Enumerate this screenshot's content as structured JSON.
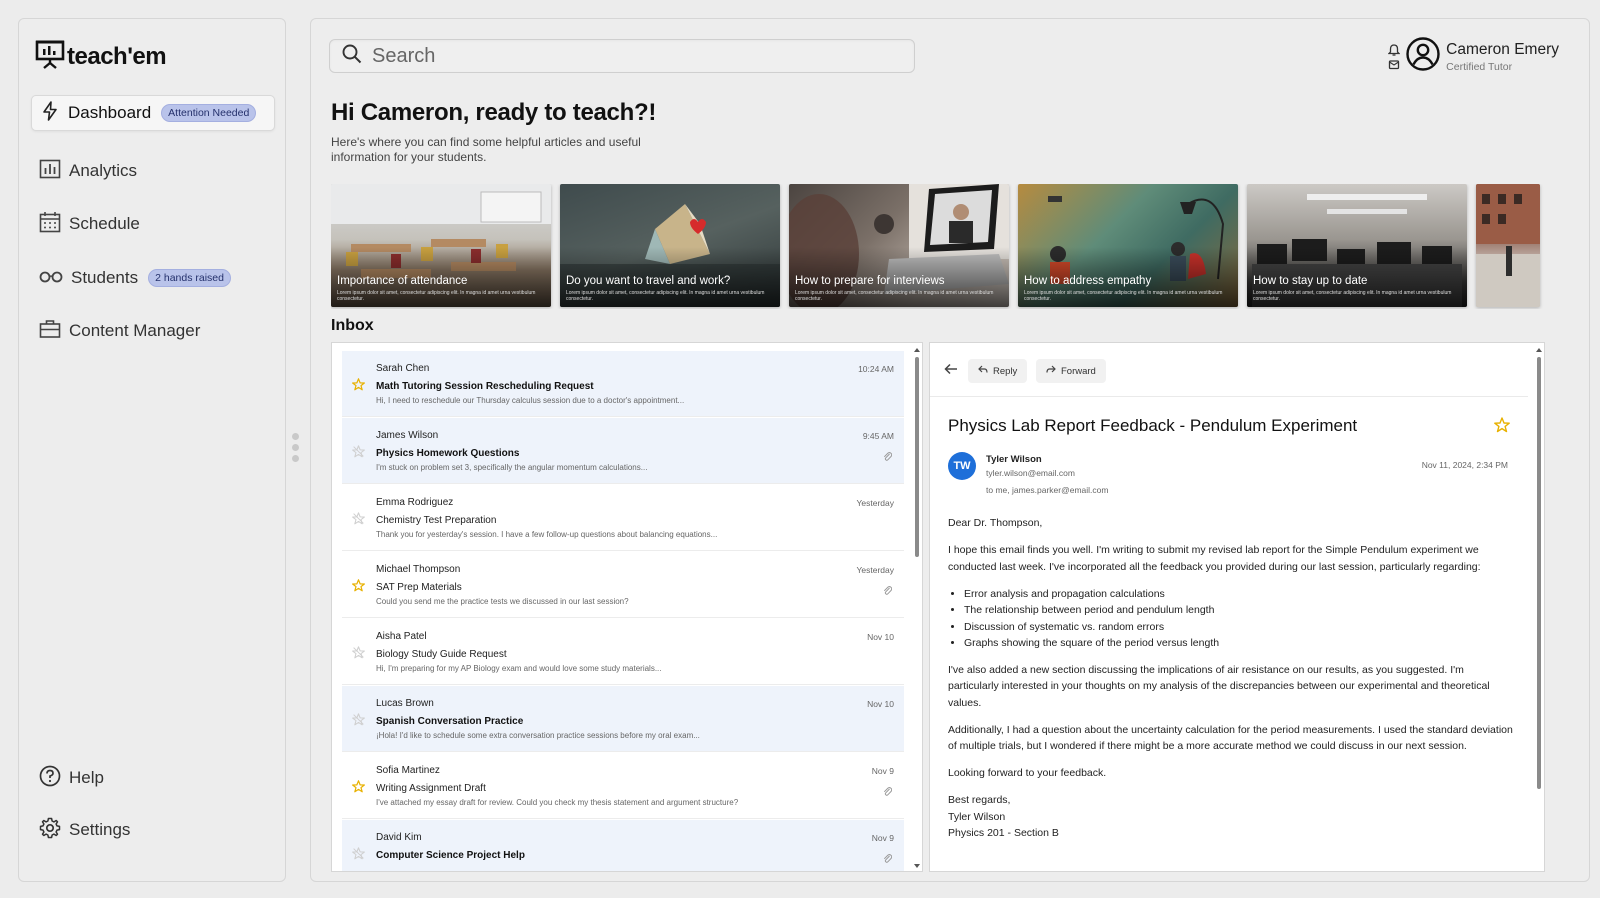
{
  "app": {
    "name": "teach'em"
  },
  "sidebar": {
    "items": [
      {
        "label": "Dashboard",
        "badge": "Attention Needed",
        "icon": "bolt-icon"
      },
      {
        "label": "Analytics",
        "icon": "bar-chart-icon"
      },
      {
        "label": "Schedule",
        "icon": "calendar-icon"
      },
      {
        "label": "Students",
        "badge": "2 hands raised",
        "icon": "glasses-icon"
      },
      {
        "label": "Content Manager",
        "icon": "briefcase-icon"
      }
    ],
    "bottom": [
      {
        "label": "Help",
        "icon": "help-circle-icon"
      },
      {
        "label": "Settings",
        "icon": "gear-icon"
      }
    ]
  },
  "search": {
    "placeholder": "Search"
  },
  "user": {
    "name": "Cameron Emery",
    "role": "Certified Tutor"
  },
  "greeting": {
    "title": "Hi Cameron, ready to teach?!",
    "subtitle": "Here's where you can find some helpful articles and useful information for your students."
  },
  "articles": {
    "lorem": "Lorem ipsum dolor sit amet, consectetur adipiscing elit. In magna id amet urna vestibulum consectetur.",
    "items": [
      {
        "title": "Importance of attendance"
      },
      {
        "title": "Do you want to travel and work?"
      },
      {
        "title": "How to prepare for interviews"
      },
      {
        "title": "How to address empathy"
      },
      {
        "title": "How to stay up to date"
      }
    ]
  },
  "inbox": {
    "label": "Inbox",
    "messages": [
      {
        "from": "Sarah Chen",
        "subject": "Math Tutoring Session Rescheduling Request",
        "preview": "Hi, I need to reschedule our Thursday calculus session due to a doctor's appointment...",
        "time": "10:24 AM",
        "unread": true,
        "starred": true,
        "attachment": false
      },
      {
        "from": "James Wilson",
        "subject": "Physics Homework Questions",
        "preview": "I'm stuck on problem set 3, specifically the angular momentum calculations...",
        "time": "9:45 AM",
        "unread": true,
        "starred": false,
        "attachment": true
      },
      {
        "from": "Emma Rodriguez",
        "subject": "Chemistry Test Preparation",
        "preview": "Thank you for yesterday's session. I have a few follow-up questions about balancing equations...",
        "time": "Yesterday",
        "unread": false,
        "starred": false,
        "attachment": false
      },
      {
        "from": "Michael Thompson",
        "subject": "SAT Prep Materials",
        "preview": "Could you send me the practice tests we discussed in our last session?",
        "time": "Yesterday",
        "unread": false,
        "starred": true,
        "attachment": true
      },
      {
        "from": "Aisha Patel",
        "subject": "Biology Study Guide Request",
        "preview": "Hi, I'm preparing for my AP Biology exam and would love some study materials...",
        "time": "Nov 10",
        "unread": false,
        "starred": false,
        "attachment": false
      },
      {
        "from": "Lucas Brown",
        "subject": "Spanish Conversation Practice",
        "preview": "¡Hola! I'd like to schedule some extra conversation practice sessions before my oral exam...",
        "time": "Nov 10",
        "unread": true,
        "starred": false,
        "attachment": false
      },
      {
        "from": "Sofia Martinez",
        "subject": "Writing Assignment Draft",
        "preview": "I've attached my essay draft for review. Could you check my thesis statement and argument structure?",
        "time": "Nov 9",
        "unread": false,
        "starred": true,
        "attachment": true
      },
      {
        "from": "David Kim",
        "subject": "Computer Science Project Help",
        "preview": "",
        "time": "Nov 9",
        "unread": true,
        "starred": false,
        "attachment": true
      }
    ]
  },
  "email": {
    "reply_label": "Reply",
    "forward_label": "Forward",
    "title": "Physics Lab Report Feedback - Pendulum Experiment",
    "avatar": "TW",
    "sender": "Tyler Wilson",
    "sender_email": "tyler.wilson@email.com",
    "to": "to me, james.parker@email.com",
    "date": "Nov 11, 2024, 2:34 PM",
    "salutation": "Dear Dr. Thompson,",
    "p1": "I hope this email finds you well. I'm writing to submit my revised lab report for the Simple Pendulum experiment we conducted last week. I've incorporated all the feedback you provided during our last session, particularly regarding:",
    "bullets": [
      "Error analysis and propagation calculations",
      "The relationship between period and pendulum length",
      "Discussion of systematic vs. random errors",
      "Graphs showing the square of the period versus length"
    ],
    "p2": "I've also added a new section discussing the implications of air resistance on our results, as you suggested. I'm particularly interested in your thoughts on my analysis of the discrepancies between our experimental and theoretical values.",
    "p3": "Additionally, I had a question about the uncertainty calculation for the period measurements. I used the standard deviation of multiple trials, but I wondered if there might be a more accurate method we could discuss in our next session.",
    "p4": "Looking forward to your feedback.",
    "signoff": "Best regards,",
    "sig_name": "Tyler Wilson",
    "sig_course": "Physics 201 - Section B"
  },
  "colors": {
    "accent": "#1e6fd9",
    "badge_bg": "#b9c3ea",
    "star": "#e8b100",
    "unread_bg": "#eef3fb"
  }
}
